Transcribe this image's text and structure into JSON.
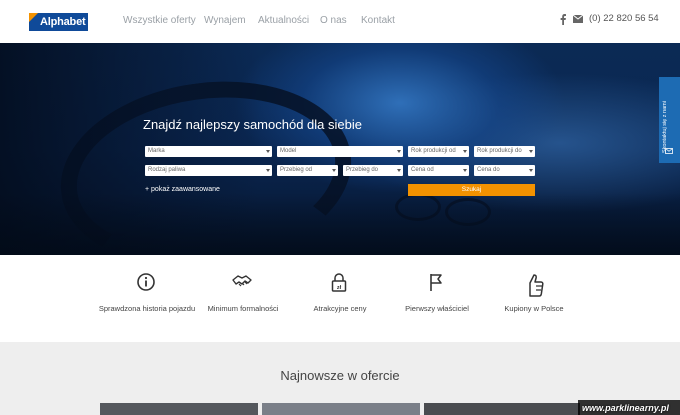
{
  "brand": {
    "logo_text": "Alphabet",
    "primary_color": "#0f4a99",
    "accent_color": "#f39200"
  },
  "nav": {
    "items": [
      {
        "label": "Wszystkie oferty"
      },
      {
        "label": "Wynajem"
      },
      {
        "label": "Aktualności"
      },
      {
        "label": "O nas"
      },
      {
        "label": "Kontakt"
      }
    ]
  },
  "header": {
    "social_icon": "facebook-icon",
    "mail_icon": "mail-icon",
    "phone": "(0) 22 820 56 54"
  },
  "hero": {
    "title": "Znajdź najlepszy samochód dla siebie",
    "filters_row1": [
      {
        "label": "Marka"
      },
      {
        "label": "Model"
      },
      {
        "label": "Rok produkcji od"
      },
      {
        "label": "Rok produkcji do"
      }
    ],
    "filters_row2": [
      {
        "label": "Rodzaj paliwa"
      },
      {
        "label": "Przebieg od"
      },
      {
        "label": "Przebieg do"
      },
      {
        "label": "Cena od"
      },
      {
        "label": "Cena do"
      }
    ],
    "advanced_link": "+ pokaż zaawansowane",
    "search_button": "Szukaj"
  },
  "side_tab": {
    "label": "Skontaktuj się z nami",
    "icon": "mail-icon"
  },
  "features": [
    {
      "icon": "info-icon",
      "label": "Sprawdzona historia pojazdu"
    },
    {
      "icon": "handshake-icon",
      "label": "Minimum formalności"
    },
    {
      "icon": "price-lock-icon",
      "label": "Atrakcyjne ceny"
    },
    {
      "icon": "flag-icon",
      "label": "Pierwszy właściciel"
    },
    {
      "icon": "thumbs-up-icon",
      "label": "Kupiony w Polsce"
    }
  ],
  "latest": {
    "title": "Najnowsze w ofercie"
  },
  "watermark": "www.parklinearny.pl"
}
